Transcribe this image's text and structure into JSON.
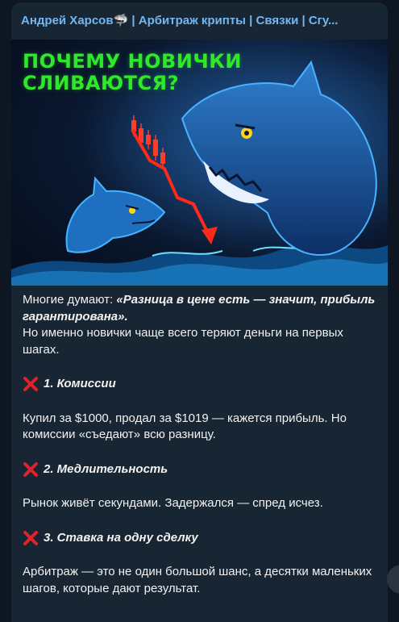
{
  "channel": {
    "title": "Андрей Харсов🦈 | Арбитраж крипты | Связки | Сгу..."
  },
  "cover": {
    "headline_line1": "ПОЧЕМУ НОВИЧКИ",
    "headline_line2": "СЛИВАЮТСЯ?",
    "headline_color": "#2ee82a",
    "arrow_color": "#ff2a1a"
  },
  "post": {
    "intro_prefix": "Многие думают: ",
    "intro_quote": "«Разница в цене есть — значит, прибыль гарантирована».",
    "intro_line2": "Но именно новички чаще всего теряют деньги на первых шагах.",
    "sections": [
      {
        "icon": "cross-mark-icon",
        "heading": "1. Комиссии",
        "body": "Купил за $1000, продал за $1019 — кажется прибыль. Но комиссии «съедают» всю разницу."
      },
      {
        "icon": "cross-mark-icon",
        "heading": "2. Медлительность",
        "body": "Рынок живёт секундами. Задержался — спред исчез."
      },
      {
        "icon": "cross-mark-icon",
        "heading": "3. Ставка на одну сделку",
        "body": "Арбитраж — это не один большой шанс, а десятки маленьких шагов, которые дают результат."
      }
    ]
  }
}
